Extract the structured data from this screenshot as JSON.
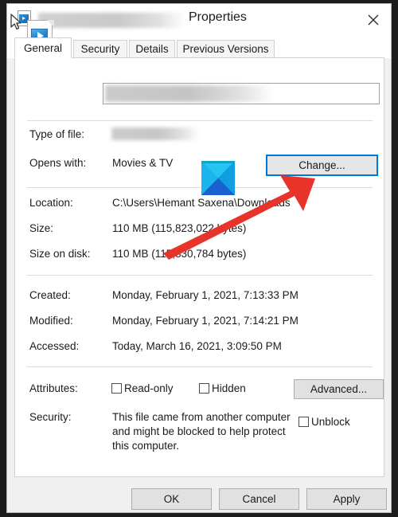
{
  "window": {
    "title": "Properties",
    "title_redacted_filename": "",
    "icon": "video-file-icon",
    "close_label": "✕"
  },
  "tabs": [
    {
      "label": "General",
      "active": true
    },
    {
      "label": "Security",
      "active": false
    },
    {
      "label": "Details",
      "active": false
    },
    {
      "label": "Previous Versions",
      "active": false
    }
  ],
  "general": {
    "filename_value": "",
    "filename_placeholder": "",
    "rows": [
      {
        "label": "Type of file:",
        "value": "",
        "redacted": true
      },
      {
        "label": "Opens with:",
        "value": "Movies & TV",
        "redacted": false
      },
      {
        "label": "Location:",
        "value": "C:\\Users\\Hemant Saxena\\Downloads",
        "redacted": false
      },
      {
        "label": "Size:",
        "value": "110 MB (115,823,022 bytes)",
        "redacted": false
      },
      {
        "label": "Size on disk:",
        "value": "110 MB (115,830,784 bytes)",
        "redacted": false
      },
      {
        "label": "Created:",
        "value": "Monday, February 1, 2021, 7:13:33 PM",
        "redacted": false
      },
      {
        "label": "Modified:",
        "value": "Monday, February 1, 2021, 7:14:21 PM",
        "redacted": false
      },
      {
        "label": "Accessed:",
        "value": "Today, March 16, 2021, 3:09:50 PM",
        "redacted": false
      }
    ],
    "change_button": "Change...",
    "attributes_label": "Attributes:",
    "readonly_label": "Read-only",
    "readonly_checked": false,
    "hidden_label": "Hidden",
    "hidden_checked": false,
    "advanced_button": "Advanced...",
    "security_label": "Security:",
    "security_text": "This file came from another computer and might be blocked to help protect this computer.",
    "unblock_label": "Unblock",
    "unblock_checked": false
  },
  "footer": {
    "ok_label": "OK",
    "cancel_label": "Cancel",
    "apply_label": "Apply"
  },
  "annotation": {
    "arrow_color": "#e8332a",
    "arrow_description": "red-arrow-pointing-to-change-button"
  },
  "colors": {
    "focus_blue": "#0078d7",
    "dialog_background": "#f0f0f0",
    "page_background": "#ffffff",
    "button_face": "#e1e1e1",
    "text": "#1b1b1b"
  }
}
